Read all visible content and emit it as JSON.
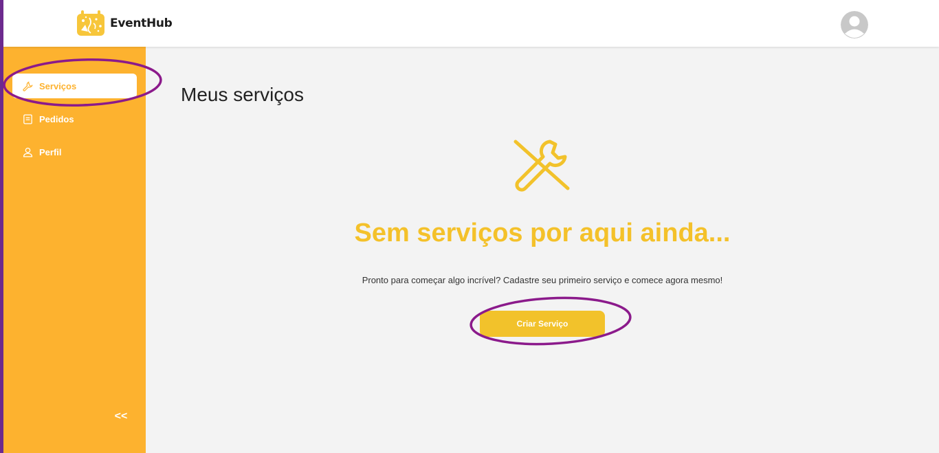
{
  "header": {
    "brand": "EventHub"
  },
  "sidebar": {
    "items": [
      {
        "label": "Serviços",
        "icon": "wrench-icon",
        "active": true
      },
      {
        "label": "Pedidos",
        "icon": "receipt-icon",
        "active": false
      },
      {
        "label": "Perfil",
        "icon": "user-icon",
        "active": false
      }
    ],
    "collapse_label": "<<"
  },
  "main": {
    "title": "Meus serviços",
    "empty_icon": "tools-icon",
    "empty_heading": "Sem serviços por aqui ainda...",
    "empty_text": "Pronto para começar algo incrível? Cadastre seu primeiro serviço e comece agora mesmo!",
    "create_button": "Criar Serviço"
  },
  "colors": {
    "sidebar": "#fdb22f",
    "accent": "#f4c12a",
    "button": "#f2c22b",
    "annotation": "#8b1a8b",
    "frame": "#6c2a8e"
  }
}
